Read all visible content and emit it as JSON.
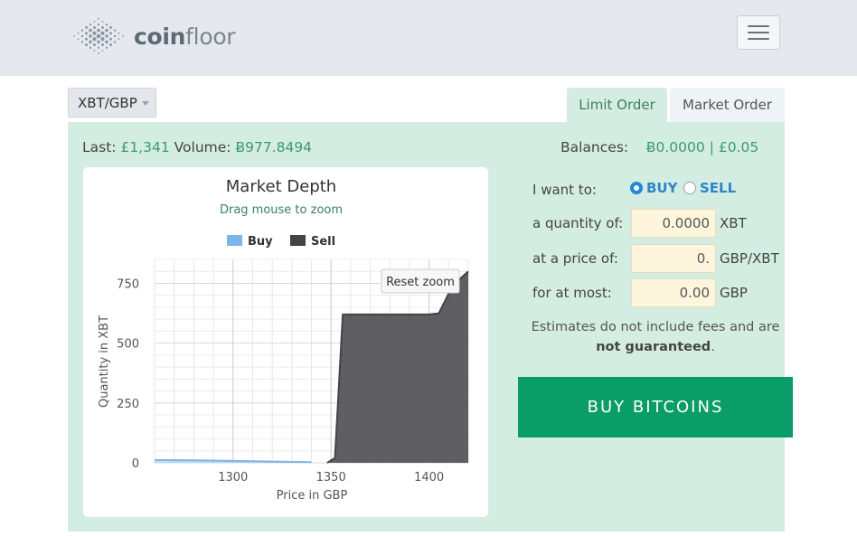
{
  "brand": {
    "name_bold": "coin",
    "name_rest": "floor",
    "logo_icon": "dot-grid-logo-icon"
  },
  "header": {
    "menu_icon": "hamburger-menu-icon"
  },
  "pair_selector": {
    "value": "XBT/GBP"
  },
  "tabs": [
    {
      "label": "Limit Order",
      "active": true
    },
    {
      "label": "Market Order",
      "active": false
    }
  ],
  "stats": {
    "last_label": "Last:",
    "last_value": "£1,341",
    "volume_label": "Volume:",
    "volume_value": "Ƀ977.8494"
  },
  "balances": {
    "label": "Balances:",
    "btc": "Ƀ0.0000",
    "separator": "|",
    "gbp": "£0.05"
  },
  "form": {
    "want_label": "I want to:",
    "buy_label": "BUY",
    "sell_label": "SELL",
    "selected": "BUY",
    "quantity_label": "a quantity of:",
    "quantity_value": "0.0000",
    "quantity_unit": "XBT",
    "price_label": "at a price of:",
    "price_value": "0.",
    "price_unit": "GBP/XBT",
    "atmost_label": "for at most:",
    "atmost_value": "0.00",
    "atmost_unit": "GBP"
  },
  "note": {
    "text": "Estimates do not include fees and are ",
    "bold": "not guaranteed",
    "end": "."
  },
  "buy_button": {
    "label": "BUY BITCOINS"
  },
  "colors": {
    "accent_green": "#0a9c69",
    "panel_green": "#d4ede2",
    "buy_series": "#7cb5ec",
    "sell_series": "#434348"
  },
  "chart_data": {
    "type": "area",
    "title": "Market Depth",
    "subtitle": "Drag mouse to zoom",
    "xlabel": "Price in GBP",
    "ylabel": "Quantity in XBT",
    "xlim": [
      1260,
      1420
    ],
    "ylim": [
      0,
      850
    ],
    "x_ticks": [
      1300,
      1350,
      1400
    ],
    "y_ticks": [
      0,
      250,
      500,
      750
    ],
    "grid": true,
    "legend": "top-center",
    "reset_zoom_label": "Reset zoom",
    "series": [
      {
        "name": "Buy",
        "color": "#7cb5ec",
        "points": [
          [
            1260,
            12
          ],
          [
            1285,
            10
          ],
          [
            1300,
            8
          ],
          [
            1320,
            5
          ],
          [
            1340,
            3
          ]
        ]
      },
      {
        "name": "Sell",
        "color": "#434348",
        "points": [
          [
            1348,
            0
          ],
          [
            1352,
            20
          ],
          [
            1356,
            620
          ],
          [
            1370,
            620
          ],
          [
            1400,
            620
          ],
          [
            1405,
            625
          ],
          [
            1412,
            740
          ],
          [
            1420,
            800
          ]
        ]
      }
    ]
  }
}
